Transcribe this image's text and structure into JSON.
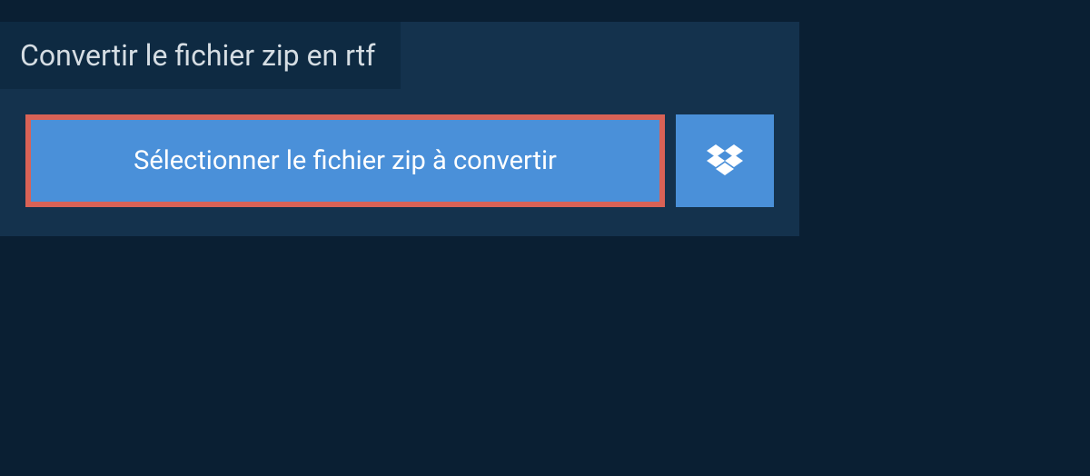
{
  "panel": {
    "title": "Convertir le fichier zip en rtf",
    "select_button_label": "Sélectionner le fichier zip à convertir"
  },
  "colors": {
    "background": "#0a1f33",
    "panel": "#14324d",
    "title_bar": "#0e2a42",
    "button": "#4a90d9",
    "button_highlight_border": "#d96256",
    "text_light": "#d5dde3",
    "text_white": "#ffffff"
  }
}
